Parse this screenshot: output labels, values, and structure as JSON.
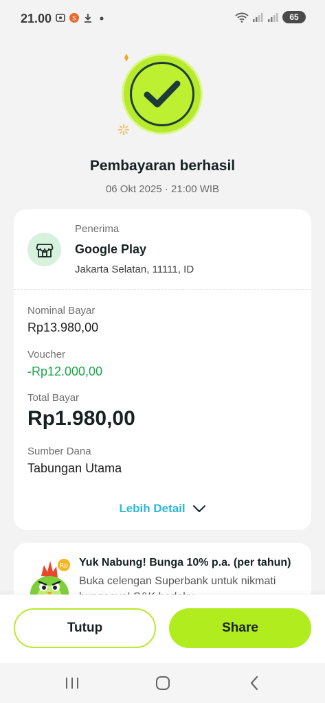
{
  "status_bar": {
    "time": "21.00",
    "battery": "65",
    "icons": [
      "screenshot-icon",
      "app-badge-icon",
      "download-icon",
      "dot-icon",
      "wifi-icon",
      "signal-icon",
      "signal-icon",
      "battery-icon"
    ]
  },
  "hero": {
    "title": "Pembayaran berhasil",
    "datetime": "06 Okt 2025 · 21:00 WIB",
    "icon": "check-icon"
  },
  "recipient": {
    "label": "Penerima",
    "name": "Google Play",
    "address": "Jakarta Selatan, 11111, ID",
    "icon": "store-icon"
  },
  "details": [
    {
      "label": "Nominal Bayar",
      "value": "Rp13.980,00"
    },
    {
      "label": "Voucher",
      "value": "-Rp12.000,00"
    },
    {
      "label": "Total Bayar",
      "value": "Rp1.980,00"
    },
    {
      "label": "Sumber Dana",
      "value": "Tabungan Utama"
    }
  ],
  "more_detail": {
    "label": "Lebih Detail",
    "icon": "chevron-down-icon"
  },
  "promo": {
    "title": "Yuk Nabung! Bunga 10% p.a. (per tahun)",
    "body": "Buka celengan Superbank untuk nikmati bunganya! S&K berlaku."
  },
  "actions": {
    "close_label": "Tutup",
    "share_label": "Share"
  },
  "colors": {
    "accent": "#b1ec1f",
    "link": "#2bb7de",
    "discount": "#1aa64b",
    "dark": "#172122"
  }
}
